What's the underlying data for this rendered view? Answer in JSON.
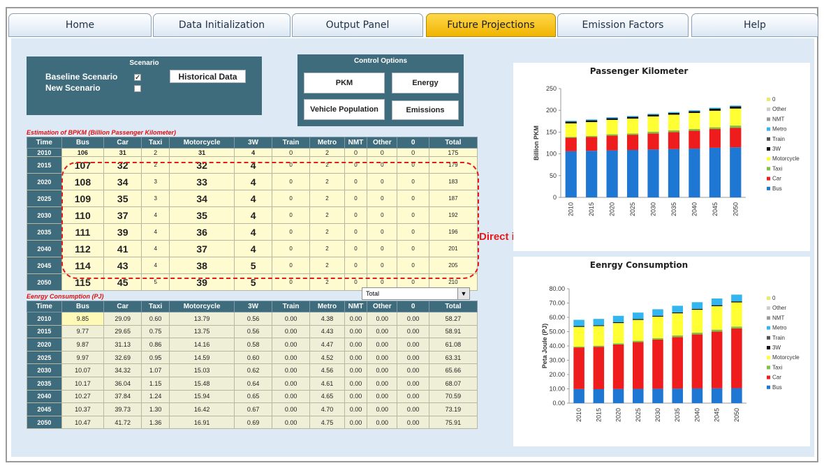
{
  "tabs": [
    {
      "label": "Home",
      "active": false
    },
    {
      "label": "Data Initialization",
      "active": false
    },
    {
      "label": "Output Panel",
      "active": false
    },
    {
      "label": "Future Projections",
      "active": true
    },
    {
      "label": "Emission Factors",
      "active": false
    },
    {
      "label": "Help",
      "active": false
    }
  ],
  "scenario": {
    "title": "Scenario",
    "baseline_label": "Baseline Scenario",
    "baseline_checked": true,
    "new_label": "New Scenario",
    "new_checked": false,
    "historical_button": "Historical Data"
  },
  "control": {
    "title": "Control Options",
    "pkm_button": "PKM",
    "energy_button": "Energy",
    "vehicle_button": "Vehicle Population",
    "emissions_button": "Emissions"
  },
  "bpkm": {
    "title": "Estimation of  BPKM (Billion Passenger Kilometer)",
    "columns": [
      "Time",
      "Bus",
      "Car",
      "Taxi",
      "Motorcycle",
      "3W",
      "Train",
      "Metro",
      "NMT",
      "Other",
      "0",
      "Total"
    ],
    "rows": [
      [
        "2010",
        "106",
        "31",
        "2",
        "31",
        "4",
        "0",
        "2",
        "0",
        "0",
        "0",
        "175"
      ],
      [
        "2015",
        "107",
        "32",
        "2",
        "32",
        "4",
        "0",
        "2",
        "0",
        "0",
        "0",
        "179"
      ],
      [
        "2020",
        "108",
        "34",
        "3",
        "33",
        "4",
        "0",
        "2",
        "0",
        "0",
        "0",
        "183"
      ],
      [
        "2025",
        "109",
        "35",
        "3",
        "34",
        "4",
        "0",
        "2",
        "0",
        "0",
        "0",
        "187"
      ],
      [
        "2030",
        "110",
        "37",
        "4",
        "35",
        "4",
        "0",
        "2",
        "0",
        "0",
        "0",
        "192"
      ],
      [
        "2035",
        "111",
        "39",
        "4",
        "36",
        "4",
        "0",
        "2",
        "0",
        "0",
        "0",
        "196"
      ],
      [
        "2040",
        "112",
        "41",
        "4",
        "37",
        "4",
        "0",
        "2",
        "0",
        "0",
        "0",
        "201"
      ],
      [
        "2045",
        "114",
        "43",
        "4",
        "38",
        "5",
        "0",
        "2",
        "0",
        "0",
        "0",
        "205"
      ],
      [
        "2050",
        "115",
        "45",
        "5",
        "39",
        "5",
        "0",
        "2",
        "0",
        "0",
        "0",
        "210"
      ]
    ]
  },
  "annotation": "Direct input by the user",
  "dropdown_value": "Total",
  "energy": {
    "title": "Eenrgy Consumption (PJ)",
    "columns": [
      "Time",
      "Bus",
      "Car",
      "Taxi",
      "Motorcycle",
      "3W",
      "Train",
      "Metro",
      "NMT",
      "Other",
      "0",
      "Total"
    ],
    "rows": [
      [
        "2010",
        "9.85",
        "29.09",
        "0.60",
        "13.79",
        "0.56",
        "0.00",
        "4.38",
        "0.00",
        "0.00",
        "0.00",
        "58.27"
      ],
      [
        "2015",
        "9.77",
        "29.65",
        "0.75",
        "13.75",
        "0.56",
        "0.00",
        "4.43",
        "0.00",
        "0.00",
        "0.00",
        "58.91"
      ],
      [
        "2020",
        "9.87",
        "31.13",
        "0.86",
        "14.16",
        "0.58",
        "0.00",
        "4.47",
        "0.00",
        "0.00",
        "0.00",
        "61.08"
      ],
      [
        "2025",
        "9.97",
        "32.69",
        "0.95",
        "14.59",
        "0.60",
        "0.00",
        "4.52",
        "0.00",
        "0.00",
        "0.00",
        "63.31"
      ],
      [
        "2030",
        "10.07",
        "34.32",
        "1.07",
        "15.03",
        "0.62",
        "0.00",
        "4.56",
        "0.00",
        "0.00",
        "0.00",
        "65.66"
      ],
      [
        "2035",
        "10.17",
        "36.04",
        "1.15",
        "15.48",
        "0.64",
        "0.00",
        "4.61",
        "0.00",
        "0.00",
        "0.00",
        "68.07"
      ],
      [
        "2040",
        "10.27",
        "37.84",
        "1.24",
        "15.94",
        "0.65",
        "0.00",
        "4.65",
        "0.00",
        "0.00",
        "0.00",
        "70.59"
      ],
      [
        "2045",
        "10.37",
        "39.73",
        "1.30",
        "16.42",
        "0.67",
        "0.00",
        "4.70",
        "0.00",
        "0.00",
        "0.00",
        "73.19"
      ],
      [
        "2050",
        "10.47",
        "41.72",
        "1.36",
        "16.91",
        "0.69",
        "0.00",
        "4.75",
        "0.00",
        "0.00",
        "0.00",
        "75.91"
      ]
    ]
  },
  "series_colors": {
    "Bus": "#1f77d4",
    "Car": "#ee1c1c",
    "Taxi": "#7fc242",
    "Motorcycle": "#ffff33",
    "3W": "#111111",
    "Train": "#555555",
    "Metro": "#33b5f0",
    "NMT": "#999999",
    "Other": "#cccccc",
    "0": "#eaea6a"
  },
  "chart_data": [
    {
      "type": "bar",
      "stacked": true,
      "title": "Passenger Kilometer",
      "ylabel": "Billion PKM",
      "ylim": [
        0,
        250
      ],
      "yticks": [
        "0",
        "50",
        "100",
        "150",
        "200",
        "250"
      ],
      "categories": [
        "2010",
        "2015",
        "2020",
        "2025",
        "2030",
        "2035",
        "2040",
        "2045",
        "2050"
      ],
      "legend": [
        "0",
        "Other",
        "NMT",
        "Metro",
        "Train",
        "3W",
        "Motorcycle",
        "Taxi",
        "Car",
        "Bus"
      ],
      "series": [
        {
          "name": "Bus",
          "values": [
            106,
            107,
            108,
            109,
            110,
            111,
            112,
            114,
            115
          ]
        },
        {
          "name": "Car",
          "values": [
            31,
            32,
            34,
            35,
            37,
            39,
            41,
            43,
            45
          ]
        },
        {
          "name": "Taxi",
          "values": [
            2,
            2,
            3,
            3,
            4,
            4,
            4,
            4,
            5
          ]
        },
        {
          "name": "Motorcycle",
          "values": [
            31,
            32,
            33,
            34,
            35,
            36,
            37,
            38,
            39
          ]
        },
        {
          "name": "3W",
          "values": [
            4,
            4,
            4,
            4,
            4,
            4,
            4,
            5,
            5
          ]
        },
        {
          "name": "Train",
          "values": [
            0,
            0,
            0,
            0,
            0,
            0,
            0,
            0,
            0
          ]
        },
        {
          "name": "Metro",
          "values": [
            2,
            2,
            2,
            2,
            2,
            2,
            2,
            2,
            2
          ]
        },
        {
          "name": "NMT",
          "values": [
            0,
            0,
            0,
            0,
            0,
            0,
            0,
            0,
            0
          ]
        },
        {
          "name": "Other",
          "values": [
            0,
            0,
            0,
            0,
            0,
            0,
            0,
            0,
            0
          ]
        },
        {
          "name": "0",
          "values": [
            0,
            0,
            0,
            0,
            0,
            0,
            0,
            0,
            0
          ]
        }
      ]
    },
    {
      "type": "bar",
      "stacked": true,
      "title": "Eenrgy Consumption",
      "ylabel": "Peta Joule (PJ)",
      "ylim": [
        0,
        80
      ],
      "yticks": [
        "0.00",
        "10.00",
        "20.00",
        "30.00",
        "40.00",
        "50.00",
        "60.00",
        "70.00",
        "80.00"
      ],
      "categories": [
        "2010",
        "2015",
        "2020",
        "2025",
        "2030",
        "2035",
        "2040",
        "2045",
        "2050"
      ],
      "legend": [
        "0",
        "Other",
        "NMT",
        "Metro",
        "Train",
        "3W",
        "Motorcycle",
        "Taxi",
        "Car",
        "Bus"
      ],
      "series": [
        {
          "name": "Bus",
          "values": [
            9.85,
            9.77,
            9.87,
            9.97,
            10.07,
            10.17,
            10.27,
            10.37,
            10.47
          ]
        },
        {
          "name": "Car",
          "values": [
            29.09,
            29.65,
            31.13,
            32.69,
            34.32,
            36.04,
            37.84,
            39.73,
            41.72
          ]
        },
        {
          "name": "Taxi",
          "values": [
            0.6,
            0.75,
            0.86,
            0.95,
            1.07,
            1.15,
            1.24,
            1.3,
            1.36
          ]
        },
        {
          "name": "Motorcycle",
          "values": [
            13.79,
            13.75,
            14.16,
            14.59,
            15.03,
            15.48,
            15.94,
            16.42,
            16.91
          ]
        },
        {
          "name": "3W",
          "values": [
            0.56,
            0.56,
            0.58,
            0.6,
            0.62,
            0.64,
            0.65,
            0.67,
            0.69
          ]
        },
        {
          "name": "Train",
          "values": [
            0,
            0,
            0,
            0,
            0,
            0,
            0,
            0,
            0
          ]
        },
        {
          "name": "Metro",
          "values": [
            4.38,
            4.43,
            4.47,
            4.52,
            4.56,
            4.61,
            4.65,
            4.7,
            4.75
          ]
        },
        {
          "name": "NMT",
          "values": [
            0,
            0,
            0,
            0,
            0,
            0,
            0,
            0,
            0
          ]
        },
        {
          "name": "Other",
          "values": [
            0,
            0,
            0,
            0,
            0,
            0,
            0,
            0,
            0
          ]
        },
        {
          "name": "0",
          "values": [
            0,
            0,
            0,
            0,
            0,
            0,
            0,
            0,
            0
          ]
        }
      ]
    }
  ]
}
